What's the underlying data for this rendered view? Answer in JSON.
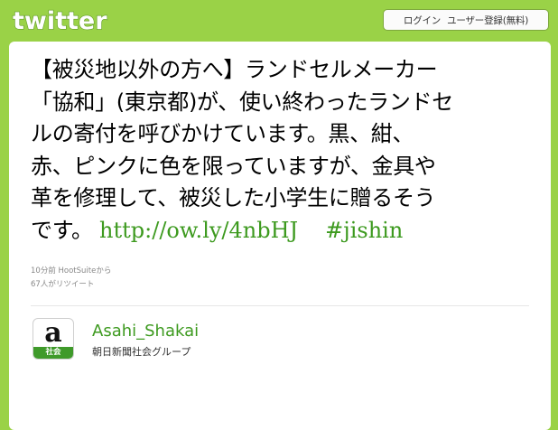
{
  "header": {
    "logo_text": "twitter",
    "login_label": "ログイン",
    "signup_label": "ユーザー登録(無料)"
  },
  "tweet": {
    "lines": [
      "【被災地以外の方へ】ランドセルメーカー",
      "「協和」(東京都)が、使い終わったランドセ",
      "ルの寄付を呼びかけています。黒、紺、",
      "赤、ピンクに色を限っていますが、金具や",
      "革を修理して、被災した小学生に贈るそう"
    ],
    "last_line_prefix": "です。",
    "link": "http://ow.ly/4nbHJ",
    "hashtag": "#jishin",
    "timestamp": "10分前 HootSuiteから",
    "retweets": "67人がリツイート"
  },
  "author": {
    "username": "Asahi_Shakai",
    "fullname": "朝日新聞社会グループ",
    "avatar_letter": "a",
    "avatar_label": "社会"
  },
  "colors": {
    "background": "#9ad247",
    "link": "#3d9a1f",
    "avatar_strip": "#3f9a2a"
  }
}
